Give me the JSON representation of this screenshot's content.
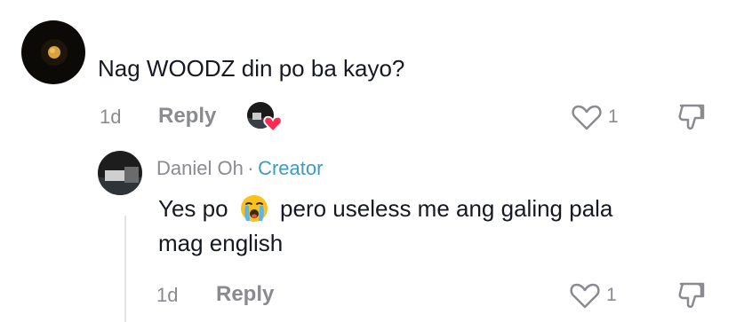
{
  "comment": {
    "text": "Nag WOODZ din po ba kayo?",
    "time": "1d",
    "reply_label": "Reply",
    "like_count": "1"
  },
  "reply": {
    "author": "Daniel Oh",
    "separator": "·",
    "badge": "Creator",
    "text_before_emoji": "Yes po",
    "text_after_emoji": "pero useless me ang galing pala",
    "text_line2": "mag english",
    "emoji": "loudly-crying-face",
    "time": "1d",
    "reply_label": "Reply",
    "like_count": "1"
  },
  "colors": {
    "text_primary": "#161823",
    "text_secondary": "#8a8b91",
    "creator_accent": "#3d9bc1",
    "heart_badge": "#fe2c55"
  }
}
